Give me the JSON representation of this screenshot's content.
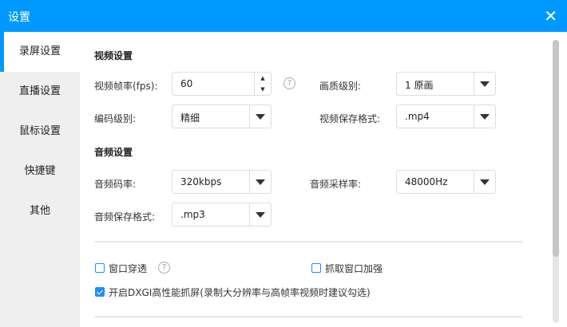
{
  "window": {
    "title": "设置",
    "close": "✕"
  },
  "sidebar": {
    "items": [
      {
        "label": "录屏设置"
      },
      {
        "label": "直播设置"
      },
      {
        "label": "鼠标设置"
      },
      {
        "label": "快捷键"
      },
      {
        "label": "其他"
      }
    ]
  },
  "video": {
    "title": "视频设置",
    "fps_label": "视频帧率(fps):",
    "fps_value": "60",
    "quality_label": "画质级别:",
    "quality_value": "1 原画",
    "encode_label": "编码级别:",
    "encode_value": "精细",
    "format_label": "视频保存格式:",
    "format_value": ".mp4"
  },
  "audio": {
    "title": "音频设置",
    "bitrate_label": "音频码率:",
    "bitrate_value": "320kbps",
    "samplerate_label": "音频采样率:",
    "samplerate_value": "48000Hz",
    "format_label": "音频保存格式:",
    "format_value": ".mp3"
  },
  "options": {
    "passthrough": "窗口穿透",
    "enhance": "抓取窗口加强",
    "dxgi": "开启DXGI高性能抓屏(录制大分辨率与高帧率视频时建议勾选)",
    "passthrough_checked": false,
    "enhance_checked": false,
    "dxgi_checked": true
  },
  "help": "?",
  "up": "▲",
  "down": "▼"
}
